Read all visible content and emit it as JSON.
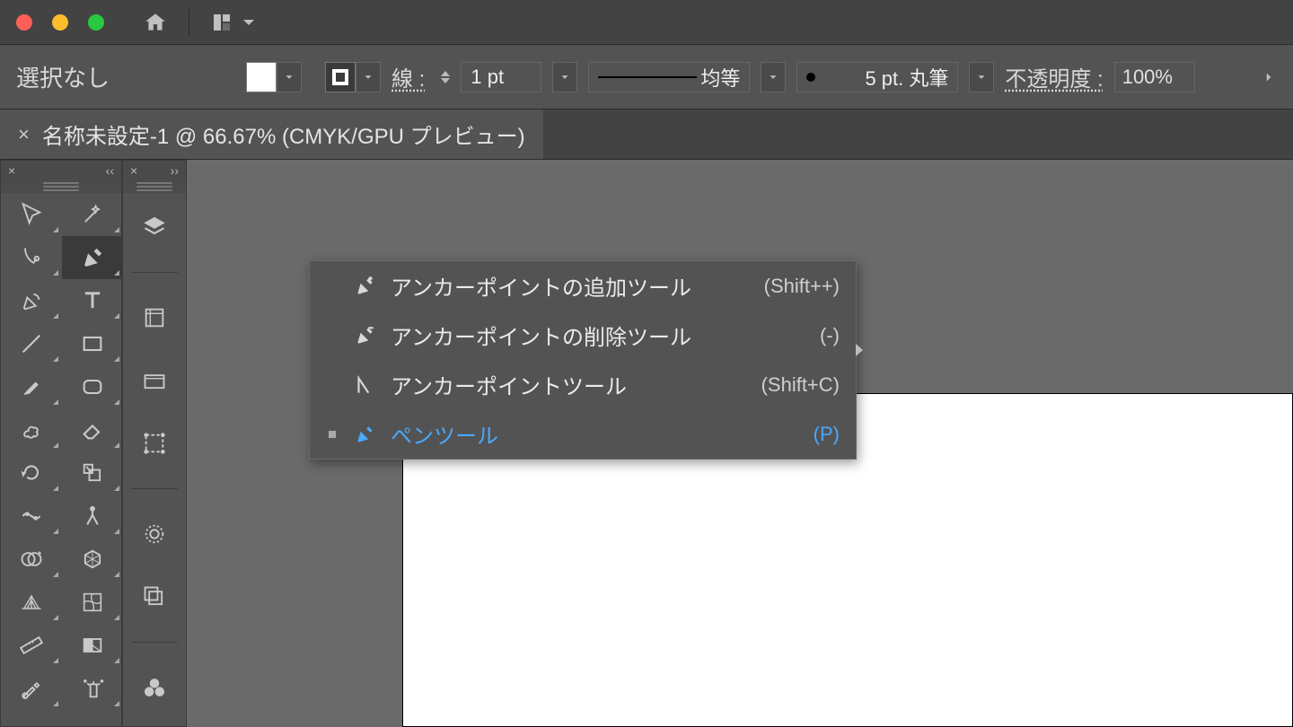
{
  "options": {
    "selection_label": "選択なし",
    "stroke_label": "線 :",
    "stroke_width": "1 pt",
    "profile": "均等",
    "brush": "5 pt. 丸筆",
    "opacity_label": "不透明度 :",
    "opacity_value": "100%"
  },
  "document": {
    "tab_title": "名称未設定-1 @ 66.67% (CMYK/GPU プレビュー)"
  },
  "flyout": {
    "items": [
      {
        "label": "アンカーポイントの追加ツール",
        "shortcut": "(Shift++)",
        "icon": "pen-plus",
        "selected": false
      },
      {
        "label": "アンカーポイントの削除ツール",
        "shortcut": "(-)",
        "icon": "pen-minus",
        "selected": false
      },
      {
        "label": "アンカーポイントツール",
        "shortcut": "(Shift+C)",
        "icon": "convert-anchor",
        "selected": false
      },
      {
        "label": "ペンツール",
        "shortcut": "(P)",
        "icon": "pen",
        "selected": true
      }
    ]
  },
  "tools_left": [
    "selection",
    "magic-wand",
    "direct-selection",
    "pen",
    "curvature",
    "type",
    "line",
    "rectangle",
    "brush",
    "rounded-rect",
    "blob-brush",
    "eraser",
    "rotate",
    "scale",
    "width",
    "pin",
    "shape-builder",
    "free-transform",
    "perspective-grid",
    "mesh",
    "ruler",
    "gradient",
    "eyedropper",
    "symbol-sprayer"
  ],
  "mini_panel": [
    "layers",
    "properties",
    "libraries",
    "artboards",
    "appearance",
    "transparency",
    "symbols"
  ]
}
